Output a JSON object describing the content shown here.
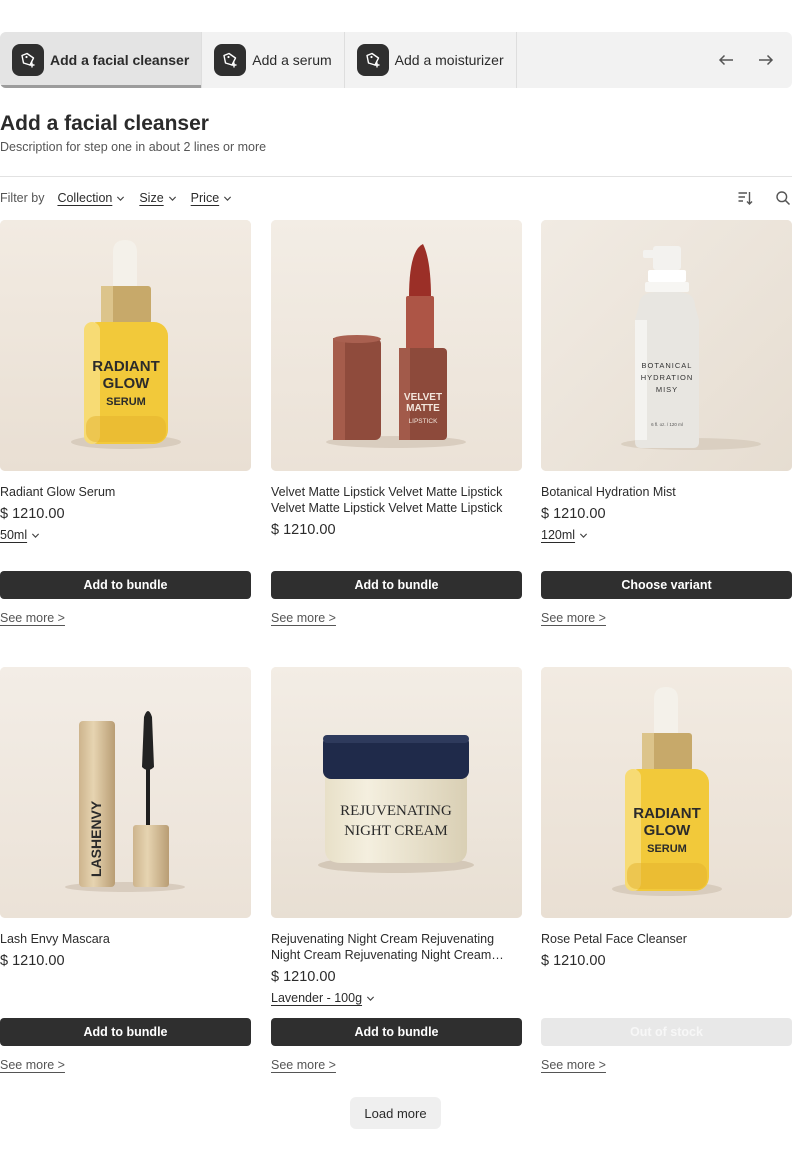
{
  "tabs": [
    {
      "label": "Add a facial cleanser",
      "icon": "add-tag-icon",
      "active": true
    },
    {
      "label": "Add a serum",
      "icon": "add-tag-icon",
      "active": false
    },
    {
      "label": "Add a moisturizer",
      "icon": "add-tag-icon",
      "active": false
    }
  ],
  "nav": {
    "prev_icon": "arrow-left-icon",
    "next_icon": "arrow-right-icon"
  },
  "header": {
    "title": "Add a facial cleanser",
    "description": "Description for step one in about 2 lines or more"
  },
  "filters": {
    "label": "Filter by",
    "items": [
      "Collection",
      "Size",
      "Price"
    ],
    "sort_icon": "sort-icon",
    "search_icon": "search-icon"
  },
  "products": [
    {
      "title": "Radiant Glow Serum",
      "price": "$ 1210.00",
      "variant": "50ml",
      "button": "Add to bundle",
      "see_more": "See more >",
      "image_text": [
        "RADIANT",
        "GLOW",
        "SERUM"
      ]
    },
    {
      "title": "Velvet Matte Lipstick Velvet Matte Lipstick Velvet Matte Lipstick Velvet Matte Lipstick",
      "price": "$ 1210.00",
      "variant": null,
      "button": "Add to bundle",
      "see_more": "See more >",
      "image_text": [
        "VELVET",
        "MATTE",
        "LIPSTICK"
      ]
    },
    {
      "title": "Botanical Hydration Mist",
      "price": "$ 1210.00",
      "variant": "120ml",
      "button": "Choose variant",
      "see_more": "See more >",
      "image_text": [
        "BOTANICAL",
        "HYDRATION",
        "MISY",
        "6 fl. oz. / 120 ml"
      ]
    },
    {
      "title": "Lash Envy Mascara",
      "price": "$ 1210.00",
      "variant": null,
      "button": "Add to bundle",
      "see_more": "See more >",
      "image_text": [
        "LASHENVY"
      ]
    },
    {
      "title": "Rejuvenating Night Cream Rejuvenating Night Cream Rejuvenating Night Cream Rejuvenating",
      "price": "$ 1210.00",
      "variant": "Lavender - 100g",
      "button": "Add to bundle",
      "see_more": "See more >",
      "image_text": [
        "REJUVENATING",
        "NIGHT CREAM"
      ]
    },
    {
      "title": "Rose Petal Face Cleanser",
      "price": "$ 1210.00",
      "variant": null,
      "button": "Out of stock",
      "button_disabled": true,
      "see_more": "See more >",
      "image_text": [
        "RADIANT",
        "GLOW",
        "SERUM"
      ]
    }
  ],
  "load_more": "Load more",
  "colors": {
    "button": "#2f2f2f",
    "tab_bg": "#f2f2f2",
    "tab_active_bg": "#e4e4e4",
    "image_bg": "#efe6dc"
  }
}
